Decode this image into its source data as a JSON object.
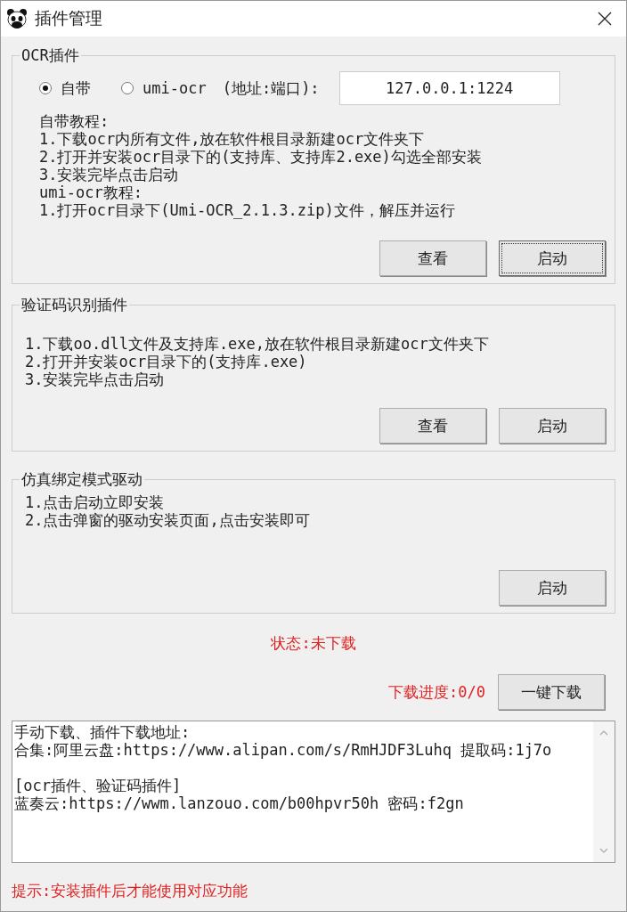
{
  "window": {
    "title": "插件管理"
  },
  "groups": [
    {
      "title": "OCR插件",
      "mode": {
        "options": [
          {
            "label": "自带",
            "selected": true
          },
          {
            "label": "umi-ocr",
            "selected": false
          }
        ],
        "address_label": "(地址:端口):",
        "address_value": "127.0.0.1:1224"
      },
      "lines": [
        "自带教程:",
        "1.下载ocr内所有文件,放在软件根目录新建ocr文件夹下",
        "2.打开并安装ocr目录下的(支持库、支持库2.exe)勾选全部安装",
        "3.安装完毕点击启动",
        "umi-ocr教程:",
        "1.打开ocr目录下(Umi-OCR_2.1.3.zip)文件，解压并运行"
      ],
      "buttons": [
        {
          "label": "查看",
          "focused": false
        },
        {
          "label": "启动",
          "focused": true
        }
      ]
    },
    {
      "title": "验证码识别插件",
      "lines": [
        "1.下载oo.dll文件及支持库.exe,放在软件根目录新建ocr文件夹下",
        "2.打开并安装ocr目录下的(支持库.exe)",
        "3.安装完毕点击启动"
      ],
      "buttons": [
        {
          "label": "查看",
          "focused": false
        },
        {
          "label": "启动",
          "focused": false
        }
      ]
    },
    {
      "title": "仿真绑定模式驱动",
      "lines": [
        "1.点击启动立即安装",
        "2.点击弹窗的驱动安装页面,点击安装即可"
      ],
      "buttons": [
        {
          "label": "启动",
          "focused": false
        }
      ]
    }
  ],
  "status": "状态:未下载",
  "progress": {
    "label": "下载进度:0/0",
    "button": "一键下载"
  },
  "links_box": {
    "paragraphs": [
      [
        "手动下载、插件下载地址:",
        "合集:阿里云盘:https://www.alipan.com/s/RmHJDF3Luhq  提取码:1j7o"
      ],
      [
        "[ocr插件、验证码插件]",
        "蓝奏云:https://wwm.lanzouo.com/b00hpvr50h   密码:f2gn"
      ]
    ]
  },
  "hint": "提示:安装插件后才能使用对应功能"
}
